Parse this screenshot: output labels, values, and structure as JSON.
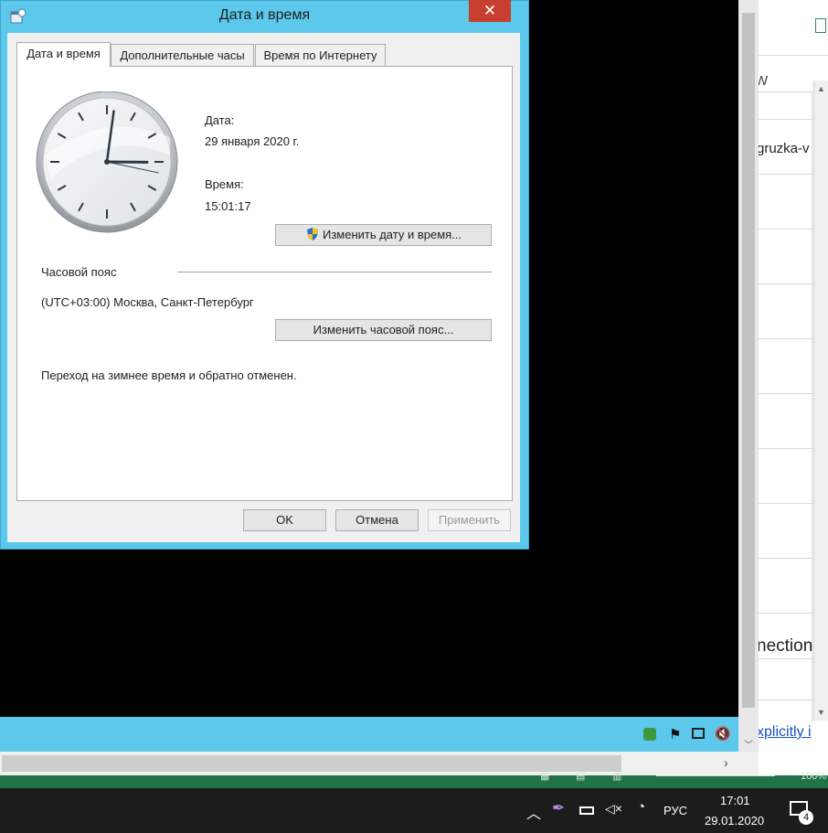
{
  "dialog": {
    "title": "Дата и время",
    "close_glyph": "✕",
    "tabs": [
      "Дата и время",
      "Дополнительные часы",
      "Время по Интернету"
    ],
    "date_label": "Дата:",
    "date_value": "29 января 2020 г.",
    "time_label": "Время:",
    "time_value": "15:01:17",
    "change_datetime_button": "Изменить дату и время...",
    "timezone_heading": "Часовой пояс",
    "timezone_value": "(UTC+03:00) Москва, Санкт-Петербург",
    "change_timezone_button": "Изменить часовой пояс...",
    "dst_note": "Переход на зимнее время и обратно отменен.",
    "ok_button": "OK",
    "cancel_button": "Отмена",
    "apply_button": "Применить"
  },
  "clock": {
    "hour": 15,
    "minute": 1,
    "second": 17
  },
  "background_app": {
    "column_letter": "W",
    "cell_1": "gruzka-v",
    "cell_2": "nection",
    "cell_3": "xplicitly i",
    "zoom": "100%"
  },
  "taskbar": {
    "language": "РУС",
    "time": "17:01",
    "date": "29.01.2020",
    "notification_count": "4"
  },
  "colors": {
    "accent": "#5bc8ec",
    "close": "#c7402f",
    "excel_green": "#217346",
    "taskbar": "#1c1c1c"
  }
}
